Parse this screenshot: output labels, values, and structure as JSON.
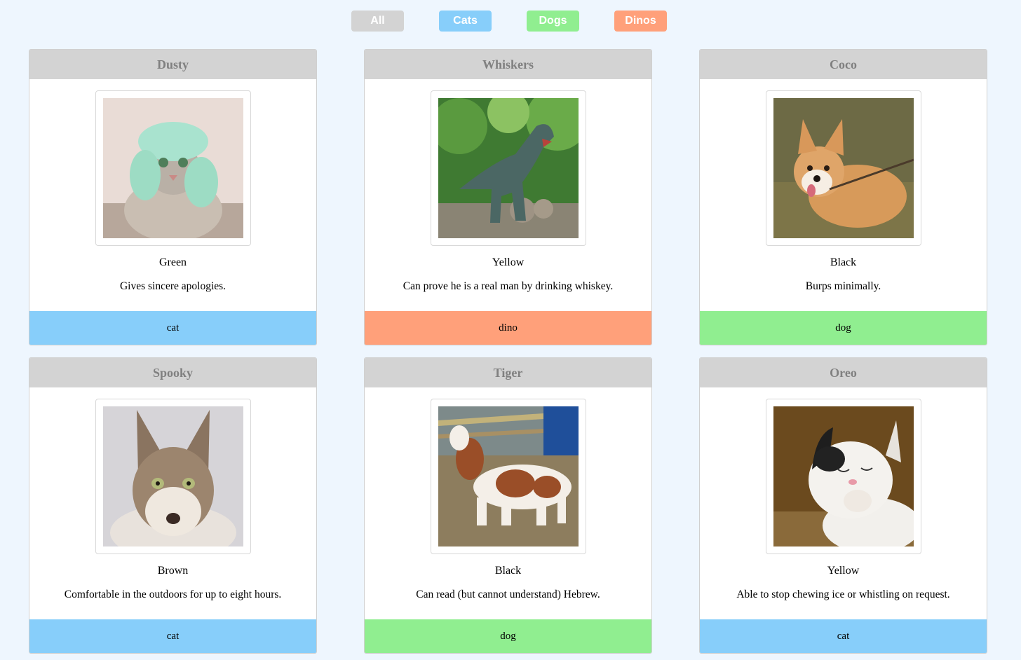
{
  "filters": [
    {
      "label": "All",
      "color": "#d3d3d3"
    },
    {
      "label": "Cats",
      "color": "#87cefa"
    },
    {
      "label": "Dogs",
      "color": "#90ee90"
    },
    {
      "label": "Dinos",
      "color": "#ffa07a"
    }
  ],
  "species_colors": {
    "cat": "#87cefa",
    "dog": "#90ee90",
    "dino": "#ffa07a"
  },
  "cards": [
    {
      "name": "Dusty",
      "color": "Green",
      "description": "Gives sincere apologies.",
      "species": "cat",
      "photo_icon": "cat-photo"
    },
    {
      "name": "Whiskers",
      "color": "Yellow",
      "description": "Can prove he is a real man by drinking whiskey.",
      "species": "dino",
      "photo_icon": "dino-photo"
    },
    {
      "name": "Coco",
      "color": "Black",
      "description": "Burps minimally.",
      "species": "dog",
      "photo_icon": "dog-photo"
    },
    {
      "name": "Spooky",
      "color": "Brown",
      "description": "Comfortable in the outdoors for up to eight hours.",
      "species": "cat",
      "photo_icon": "cat-photo"
    },
    {
      "name": "Tiger",
      "color": "Black",
      "description": "Can read (but cannot understand) Hebrew.",
      "species": "dog",
      "photo_icon": "dog-photo"
    },
    {
      "name": "Oreo",
      "color": "Yellow",
      "description": "Able to stop chewing ice or whistling on request.",
      "species": "cat",
      "photo_icon": "cat-photo"
    }
  ]
}
